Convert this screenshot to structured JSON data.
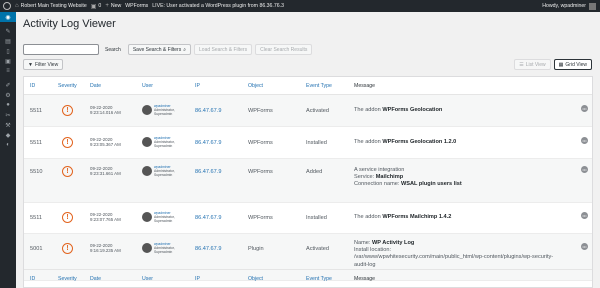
{
  "adminbar": {
    "site_name": "Robert Main Testing Website",
    "comments_count": "0",
    "new_label": "New",
    "wpforms_label": "WPForms",
    "live_notice": "LIVE: User activated a WordPress plugin from 86.36.76.3",
    "howdy": "Howdy, wpadminer"
  },
  "page": {
    "title": "Activity Log Viewer",
    "search_placeholder": "",
    "search_button": "Search",
    "save_search": "Save Search & Filters",
    "load_search": "Load Search & Filters",
    "clear_search": "Clear Search Results",
    "filter_view": "Filter View",
    "list_view": "List View",
    "grid_view": "Grid View"
  },
  "columns": {
    "id": "ID",
    "severity": "Severity",
    "date": "Date",
    "user": "User",
    "ip": "IP",
    "object": "Object",
    "event_type": "Event Type",
    "message": "Message"
  },
  "rows": [
    {
      "id": "5511",
      "date": "09-22-2020",
      "time": "9:23:14.016 AM",
      "user": "wpadminer",
      "role1": "Administrator,",
      "role2": "Superadmin",
      "ip": "86.47.67.9",
      "object": "WPForms",
      "event_type": "Activated",
      "message_pre": "The addon ",
      "message_bold": "WPForms Geolocation",
      "message_post": ""
    },
    {
      "id": "5511",
      "date": "09-22-2020",
      "time": "9:23:05.367 AM",
      "user": "wpadminer",
      "role1": "Administrator,",
      "role2": "Superadmin",
      "ip": "86.47.67.9",
      "object": "WPForms",
      "event_type": "Installed",
      "message_pre": "The addon ",
      "message_bold": "WPForms Geolocation 1.2.0",
      "message_post": ""
    },
    {
      "id": "5510",
      "date": "09-22-2020",
      "time": "9:23:31.661 AM",
      "user": "wpadminer",
      "role1": "Administrator,",
      "role2": "Superadmin",
      "ip": "86.47.67.9",
      "object": "WPForms",
      "event_type": "Added",
      "message_line1": "A service integration",
      "service_label": "Service: ",
      "service_value": "Mailchimp",
      "conn_label": "Connection name: ",
      "conn_value": "WSAL plugin users list"
    },
    {
      "id": "5511",
      "date": "09-22-2020",
      "time": "9:23:07.765 AM",
      "user": "wpadminer",
      "role1": "Administrator,",
      "role2": "Superadmin",
      "ip": "86.47.67.9",
      "object": "WPForms",
      "event_type": "Installed",
      "message_pre": "The addon ",
      "message_bold": "WPForms Mailchimp 1.4.2",
      "message_post": ""
    },
    {
      "id": "5001",
      "date": "09-22-2020",
      "time": "9:16:19.235 AM",
      "user": "wpadminer",
      "role1": "Administrator,",
      "role2": "Superadmin",
      "ip": "86.47.67.9",
      "object": "Plugin",
      "event_type": "Activated",
      "name_label": "Name: ",
      "name_value": "WP Activity Log",
      "install_label": "Install location:",
      "install_path": "/var/www/wpwhitesecurity.com/main/public_html/wp-content/plugins/wp-security-audit-log"
    }
  ],
  "colors": {
    "accent": "#2271b1",
    "severity": "#e2641f",
    "sidebar": "#23282d",
    "active_menu": "#0073aa"
  }
}
